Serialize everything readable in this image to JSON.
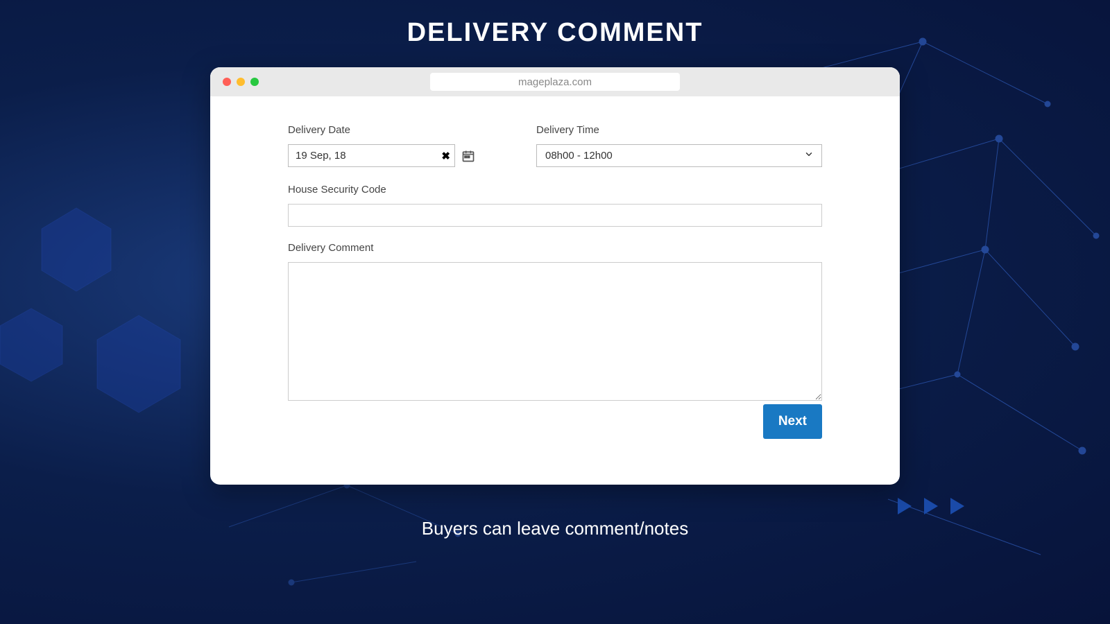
{
  "page": {
    "title": "DELIVERY COMMENT",
    "caption": "Buyers can leave comment/notes"
  },
  "browser": {
    "url": "mageplaza.com"
  },
  "form": {
    "delivery_date": {
      "label": "Delivery Date",
      "value": "19 Sep, 18"
    },
    "delivery_time": {
      "label": "Delivery Time",
      "selected": "08h00 - 12h00"
    },
    "house_security_code": {
      "label": "House Security Code",
      "value": ""
    },
    "delivery_comment": {
      "label": "Delivery Comment",
      "value": ""
    },
    "next_button": "Next"
  }
}
